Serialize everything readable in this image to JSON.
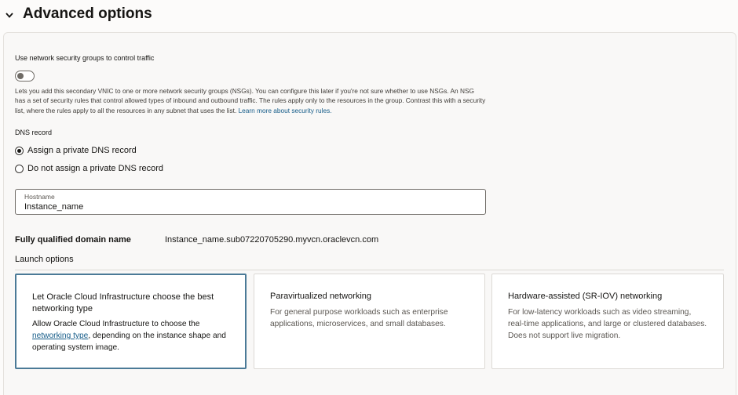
{
  "header": {
    "title": "Advanced options"
  },
  "nsg": {
    "label": "Use network security groups to control traffic",
    "enabled": false,
    "help_text": "Lets you add this secondary VNIC to one or more network security groups (NSGs). You can configure this later if you're not sure whether to use NSGs. An NSG has a set of security rules that control allowed types of inbound and outbound traffic. The rules apply only to the resources in the group. Contrast this with a security list, where the rules apply to all the resources in any subnet that uses the list. ",
    "help_link": "Learn more about security rules."
  },
  "dns": {
    "label": "DNS record",
    "options": [
      {
        "label": "Assign a private DNS record",
        "selected": true
      },
      {
        "label": "Do not assign a private DNS record",
        "selected": false
      }
    ]
  },
  "hostname": {
    "label": "Hostname",
    "value": "Instance_name"
  },
  "fqdn": {
    "label": "Fully qualified domain name",
    "value": "Instance_name.sub07220705290.myvcn.oraclevcn.com"
  },
  "launch_options": {
    "label": "Launch options",
    "cards": [
      {
        "title": "Let Oracle Cloud Infrastructure choose the best networking type",
        "desc_before": "Allow Oracle Cloud Infrastructure to choose the ",
        "desc_link": "networking type",
        "desc_after": ", depending on the instance shape and operating system image.",
        "selected": true
      },
      {
        "title": "Paravirtualized networking",
        "desc": "For general purpose workloads such as enterprise applications, microservices, and small databases.",
        "selected": false
      },
      {
        "title": "Hardware-assisted (SR-IOV) networking",
        "desc": "For low-latency workloads such as video streaming, real-time applications, and large or clustered databases. Does not support live migration.",
        "selected": false
      }
    ]
  },
  "colors": {
    "link": "#145b88",
    "selected_border": "#4b7a97",
    "text": "#161513"
  }
}
